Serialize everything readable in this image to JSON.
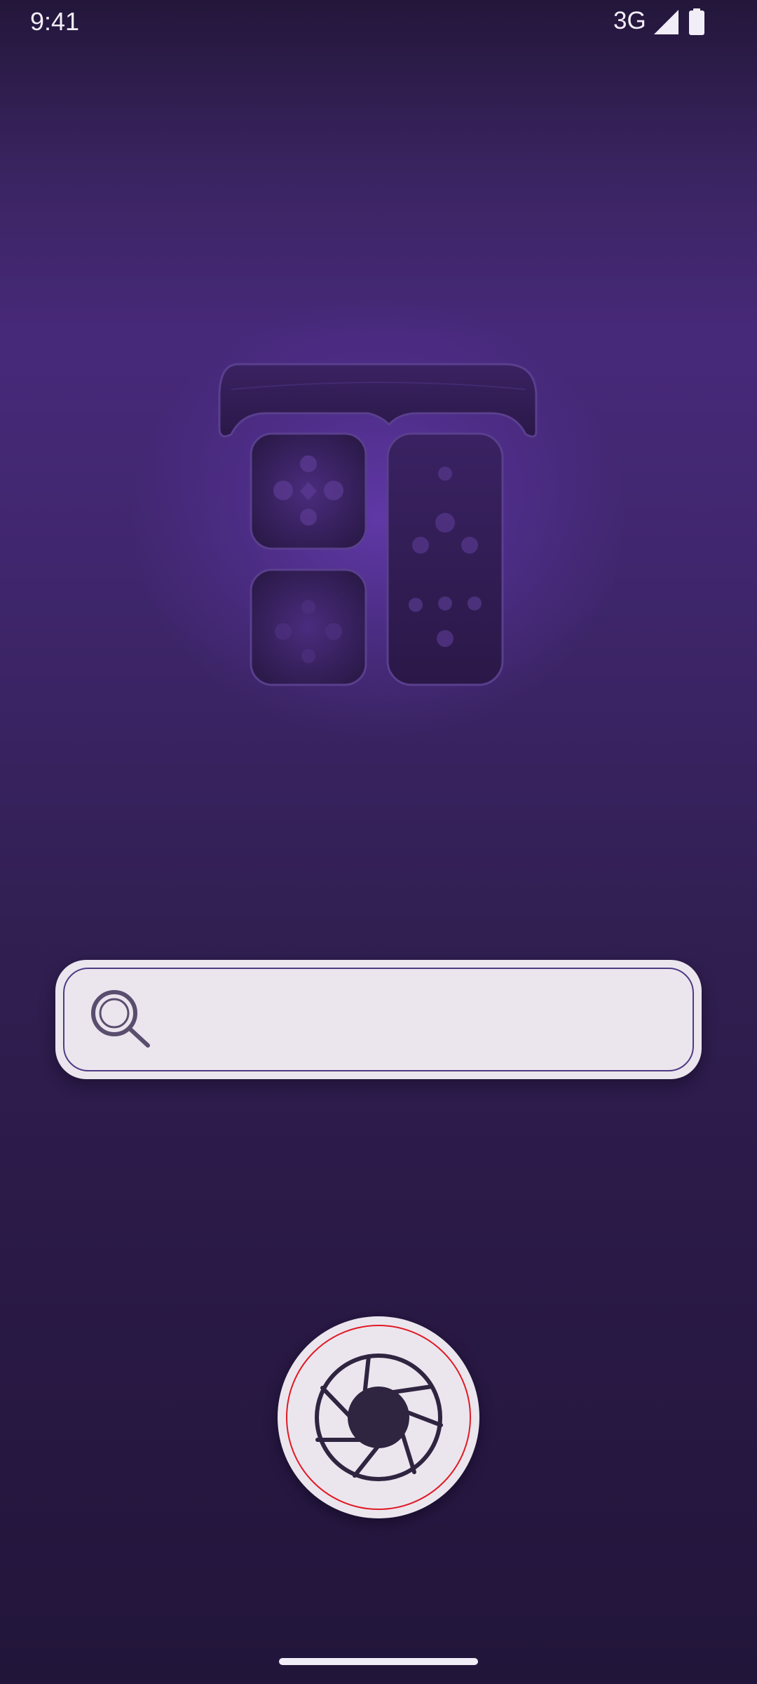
{
  "status_bar": {
    "time": "9:41",
    "network": "3G",
    "signal_icon": "signal-icon",
    "battery_icon": "battery-icon"
  },
  "logo": {
    "icon": "grid-logo-icon"
  },
  "search": {
    "icon": "search-icon",
    "value": "",
    "placeholder": ""
  },
  "camera": {
    "icon": "aperture-icon",
    "ring_color": "#e01a24"
  },
  "colors": {
    "background_top": "#23163a",
    "background_mid": "#47297a",
    "background_bottom": "#22153a",
    "surface": "#ebe6ee",
    "accent_outline": "#4e3b83"
  }
}
